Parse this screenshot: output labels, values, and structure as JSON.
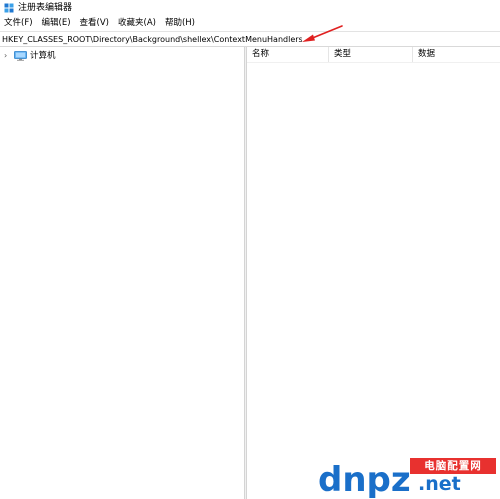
{
  "window": {
    "title": "注册表编辑器",
    "icon": "registry-editor-icon"
  },
  "menu": {
    "items": [
      {
        "label": "文件(F)"
      },
      {
        "label": "编辑(E)"
      },
      {
        "label": "查看(V)"
      },
      {
        "label": "收藏夹(A)"
      },
      {
        "label": "帮助(H)"
      }
    ]
  },
  "address": {
    "value": "HKEY_CLASSES_ROOT\\Directory\\Background\\shellex\\ContextMenuHandlers"
  },
  "annotation": {
    "arrow_color": "#e02020",
    "icon": "red-arrow-icon"
  },
  "tree": {
    "root_label": "计算机",
    "root_icon": "computer-icon",
    "expander_icon": "chevron-right-icon"
  },
  "list": {
    "columns": [
      {
        "label": "名称"
      },
      {
        "label": "类型"
      },
      {
        "label": "数据"
      }
    ]
  },
  "watermark": {
    "logo_text": "dnpz",
    "cn_text": "电脑配置网",
    "domain_suffix": ".net",
    "red": "#e8312f",
    "blue": "#1a6fc9"
  }
}
